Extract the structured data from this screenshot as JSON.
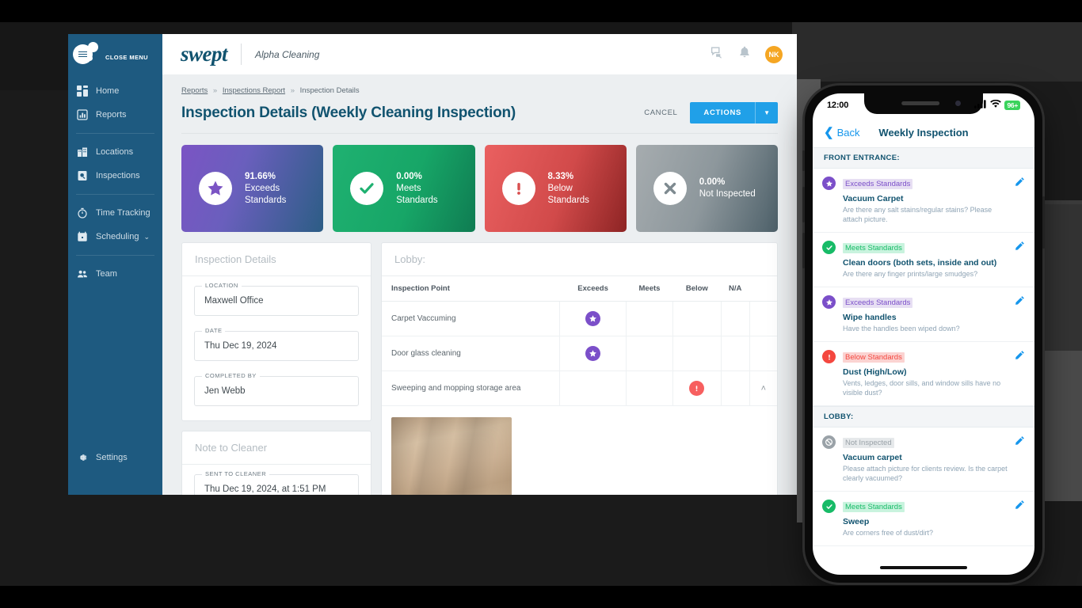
{
  "browser": {
    "sidebar": {
      "close_menu_label": "CLOSE MENU",
      "groups": [
        {
          "items": [
            {
              "label": "Home",
              "icon": "dashboard-icon"
            },
            {
              "label": "Reports",
              "icon": "bar-chart-icon"
            }
          ]
        },
        {
          "items": [
            {
              "label": "Locations",
              "icon": "building-icon"
            },
            {
              "label": "Inspections",
              "icon": "clipboard-search-icon"
            }
          ]
        },
        {
          "items": [
            {
              "label": "Time Tracking",
              "icon": "stopwatch-icon"
            },
            {
              "label": "Scheduling",
              "icon": "calendar-icon",
              "chevron": "⌄"
            }
          ]
        },
        {
          "items": [
            {
              "label": "Team",
              "icon": "people-icon"
            }
          ]
        }
      ],
      "bottom": {
        "label": "Settings",
        "icon": "gear-icon"
      }
    },
    "topbar": {
      "logo": "swept",
      "company": "Alpha Cleaning",
      "chat_icon": "chat-icon",
      "bell_icon": "bell-icon",
      "avatar_initials": "NK"
    },
    "breadcrumb": {
      "items": [
        "Reports",
        "Inspections Report",
        "Inspection Details"
      ],
      "separator": "»"
    },
    "page_title": "Inspection Details (Weekly Cleaning Inspection)",
    "actions": {
      "cancel_label": "CANCEL",
      "actions_label": "ACTIONS",
      "caret": "▼"
    },
    "stat_cards": [
      {
        "pct": "91.66%",
        "line1": "Exceeds",
        "line2": "Standards",
        "icon": "star-icon",
        "color": "#7b54c4"
      },
      {
        "pct": "0.00%",
        "line1": "Meets",
        "line2": "Standards",
        "icon": "check-icon",
        "color": "#1fb171"
      },
      {
        "pct": "8.33%",
        "line1": "Below",
        "line2": "Standards",
        "icon": "exclamation-icon",
        "color": "#ea6060"
      },
      {
        "pct": "0.00%",
        "line1": "Not Inspected",
        "line2": "",
        "icon": "x-icon",
        "color": "#8d979c"
      }
    ],
    "details_panel": {
      "title": "Inspection Details",
      "fields": [
        {
          "label": "LOCATION",
          "value": "Maxwell Office"
        },
        {
          "label": "DATE",
          "value": "Thu Dec 19, 2024"
        },
        {
          "label": "COMPLETED BY",
          "value": "Jen Webb"
        }
      ]
    },
    "note_panel": {
      "title": "Note to Cleaner",
      "fields": [
        {
          "label": "SENT TO CLEANER",
          "value": "Thu Dec 19, 2024, at 1:51 PM"
        }
      ]
    },
    "lobby_panel": {
      "title": "Lobby:",
      "columns": [
        "Inspection Point",
        "Exceeds",
        "Meets",
        "Below",
        "N/A"
      ],
      "rows": [
        {
          "point": "Carpet Vaccuming",
          "mark": "exceeds",
          "expand": ""
        },
        {
          "point": "Door glass cleaning",
          "mark": "exceeds",
          "expand": ""
        },
        {
          "point": "Sweeping and mopping storage area",
          "mark": "below",
          "expand": "˄"
        }
      ],
      "photo_alt": "wood-floor-photo"
    }
  },
  "phone": {
    "statusbar": {
      "time": "12:00",
      "battery": "96+",
      "wifi_icon": "wifi-icon",
      "signal_icon": "signal-icon"
    },
    "navbar": {
      "back_label": "Back",
      "title": "Weekly Inspection",
      "back_icon": "chevron-left-icon"
    },
    "sections": [
      {
        "header": "FRONT ENTRANCE:",
        "items": [
          {
            "status": "Exceeds Standards",
            "tone": "purple",
            "icon": "star-icon",
            "name": "Vacuum Carpet",
            "question": "Are there any salt stains/regular stains? Please attach picture.",
            "edit_icon": "pencil-icon"
          },
          {
            "status": "Meets Standards",
            "tone": "green",
            "icon": "check-icon",
            "name": "Clean doors (both sets, inside and out)",
            "question": "Are there any finger prints/large smudges?",
            "edit_icon": "pencil-icon"
          },
          {
            "status": "Exceeds Standards",
            "tone": "purple",
            "icon": "star-icon",
            "name": "Wipe handles",
            "question": "Have the handles been wiped down?",
            "edit_icon": "pencil-icon"
          },
          {
            "status": "Below Standards",
            "tone": "red",
            "icon": "exclamation-icon",
            "name": "Dust (High/Low)",
            "question": "Vents, ledges, door sills, and window sills have no visible dust?",
            "edit_icon": "pencil-icon"
          }
        ]
      },
      {
        "header": "LOBBY:",
        "items": [
          {
            "status": "Not Inspected",
            "tone": "grey",
            "icon": "no-entry-icon",
            "name": "Vacuum carpet",
            "question": "Please attach picture for clients review. Is the carpet clearly vacuumed?",
            "edit_icon": "pencil-icon"
          },
          {
            "status": "Meets Standards",
            "tone": "green",
            "icon": "check-icon",
            "name": "Sweep",
            "question": "Are corners free of dust/dirt?",
            "edit_icon": "pencil-icon"
          }
        ]
      }
    ]
  }
}
